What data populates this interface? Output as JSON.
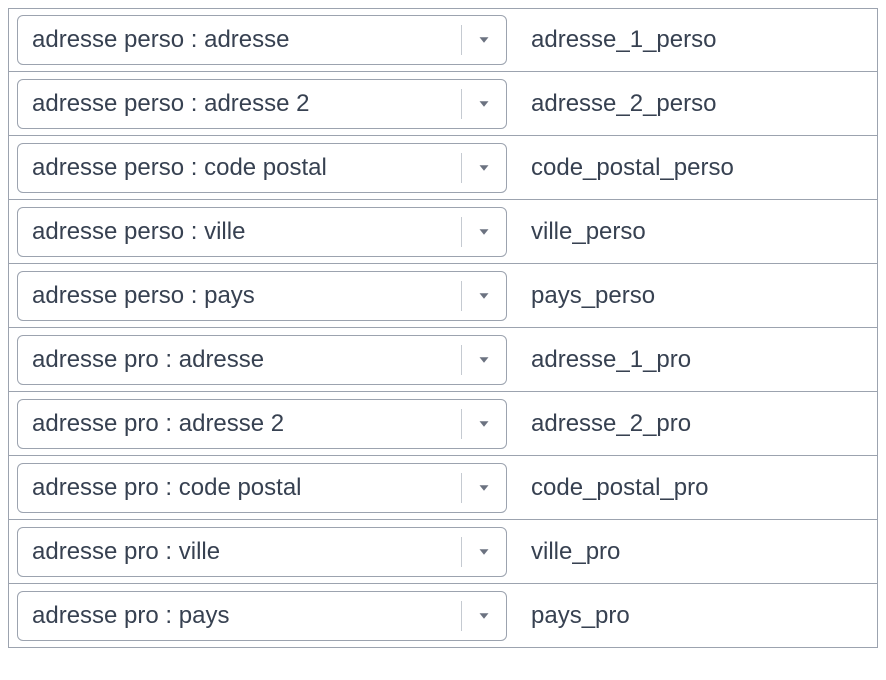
{
  "rows": [
    {
      "select_label": "adresse perso : adresse",
      "value": "adresse_1_perso"
    },
    {
      "select_label": "adresse perso : adresse 2",
      "value": "adresse_2_perso"
    },
    {
      "select_label": "adresse perso : code postal",
      "value": "code_postal_perso"
    },
    {
      "select_label": "adresse perso : ville",
      "value": "ville_perso"
    },
    {
      "select_label": "adresse perso : pays",
      "value": "pays_perso"
    },
    {
      "select_label": "adresse pro : adresse",
      "value": "adresse_1_pro"
    },
    {
      "select_label": "adresse pro : adresse 2",
      "value": "adresse_2_pro"
    },
    {
      "select_label": "adresse pro : code postal",
      "value": "code_postal_pro"
    },
    {
      "select_label": "adresse pro : ville",
      "value": "ville_pro"
    },
    {
      "select_label": "adresse pro : pays",
      "value": "pays_pro"
    }
  ]
}
